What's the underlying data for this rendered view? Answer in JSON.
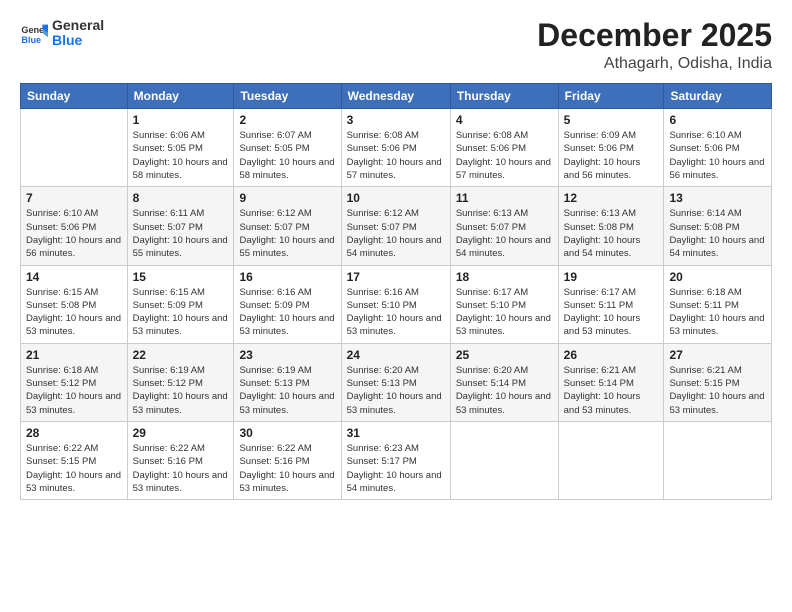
{
  "header": {
    "logo_line1": "General",
    "logo_line2": "Blue",
    "month": "December 2025",
    "location": "Athagarh, Odisha, India"
  },
  "weekdays": [
    "Sunday",
    "Monday",
    "Tuesday",
    "Wednesday",
    "Thursday",
    "Friday",
    "Saturday"
  ],
  "weeks": [
    [
      {
        "day": "",
        "sunrise": "",
        "sunset": "",
        "daylight": ""
      },
      {
        "day": "1",
        "sunrise": "6:06 AM",
        "sunset": "5:05 PM",
        "daylight": "10 hours and 58 minutes."
      },
      {
        "day": "2",
        "sunrise": "6:07 AM",
        "sunset": "5:05 PM",
        "daylight": "10 hours and 58 minutes."
      },
      {
        "day": "3",
        "sunrise": "6:08 AM",
        "sunset": "5:06 PM",
        "daylight": "10 hours and 57 minutes."
      },
      {
        "day": "4",
        "sunrise": "6:08 AM",
        "sunset": "5:06 PM",
        "daylight": "10 hours and 57 minutes."
      },
      {
        "day": "5",
        "sunrise": "6:09 AM",
        "sunset": "5:06 PM",
        "daylight": "10 hours and 56 minutes."
      },
      {
        "day": "6",
        "sunrise": "6:10 AM",
        "sunset": "5:06 PM",
        "daylight": "10 hours and 56 minutes."
      }
    ],
    [
      {
        "day": "7",
        "sunrise": "6:10 AM",
        "sunset": "5:06 PM",
        "daylight": "10 hours and 56 minutes."
      },
      {
        "day": "8",
        "sunrise": "6:11 AM",
        "sunset": "5:07 PM",
        "daylight": "10 hours and 55 minutes."
      },
      {
        "day": "9",
        "sunrise": "6:12 AM",
        "sunset": "5:07 PM",
        "daylight": "10 hours and 55 minutes."
      },
      {
        "day": "10",
        "sunrise": "6:12 AM",
        "sunset": "5:07 PM",
        "daylight": "10 hours and 54 minutes."
      },
      {
        "day": "11",
        "sunrise": "6:13 AM",
        "sunset": "5:07 PM",
        "daylight": "10 hours and 54 minutes."
      },
      {
        "day": "12",
        "sunrise": "6:13 AM",
        "sunset": "5:08 PM",
        "daylight": "10 hours and 54 minutes."
      },
      {
        "day": "13",
        "sunrise": "6:14 AM",
        "sunset": "5:08 PM",
        "daylight": "10 hours and 54 minutes."
      }
    ],
    [
      {
        "day": "14",
        "sunrise": "6:15 AM",
        "sunset": "5:08 PM",
        "daylight": "10 hours and 53 minutes."
      },
      {
        "day": "15",
        "sunrise": "6:15 AM",
        "sunset": "5:09 PM",
        "daylight": "10 hours and 53 minutes."
      },
      {
        "day": "16",
        "sunrise": "6:16 AM",
        "sunset": "5:09 PM",
        "daylight": "10 hours and 53 minutes."
      },
      {
        "day": "17",
        "sunrise": "6:16 AM",
        "sunset": "5:10 PM",
        "daylight": "10 hours and 53 minutes."
      },
      {
        "day": "18",
        "sunrise": "6:17 AM",
        "sunset": "5:10 PM",
        "daylight": "10 hours and 53 minutes."
      },
      {
        "day": "19",
        "sunrise": "6:17 AM",
        "sunset": "5:11 PM",
        "daylight": "10 hours and 53 minutes."
      },
      {
        "day": "20",
        "sunrise": "6:18 AM",
        "sunset": "5:11 PM",
        "daylight": "10 hours and 53 minutes."
      }
    ],
    [
      {
        "day": "21",
        "sunrise": "6:18 AM",
        "sunset": "5:12 PM",
        "daylight": "10 hours and 53 minutes."
      },
      {
        "day": "22",
        "sunrise": "6:19 AM",
        "sunset": "5:12 PM",
        "daylight": "10 hours and 53 minutes."
      },
      {
        "day": "23",
        "sunrise": "6:19 AM",
        "sunset": "5:13 PM",
        "daylight": "10 hours and 53 minutes."
      },
      {
        "day": "24",
        "sunrise": "6:20 AM",
        "sunset": "5:13 PM",
        "daylight": "10 hours and 53 minutes."
      },
      {
        "day": "25",
        "sunrise": "6:20 AM",
        "sunset": "5:14 PM",
        "daylight": "10 hours and 53 minutes."
      },
      {
        "day": "26",
        "sunrise": "6:21 AM",
        "sunset": "5:14 PM",
        "daylight": "10 hours and 53 minutes."
      },
      {
        "day": "27",
        "sunrise": "6:21 AM",
        "sunset": "5:15 PM",
        "daylight": "10 hours and 53 minutes."
      }
    ],
    [
      {
        "day": "28",
        "sunrise": "6:22 AM",
        "sunset": "5:15 PM",
        "daylight": "10 hours and 53 minutes."
      },
      {
        "day": "29",
        "sunrise": "6:22 AM",
        "sunset": "5:16 PM",
        "daylight": "10 hours and 53 minutes."
      },
      {
        "day": "30",
        "sunrise": "6:22 AM",
        "sunset": "5:16 PM",
        "daylight": "10 hours and 53 minutes."
      },
      {
        "day": "31",
        "sunrise": "6:23 AM",
        "sunset": "5:17 PM",
        "daylight": "10 hours and 54 minutes."
      },
      {
        "day": "",
        "sunrise": "",
        "sunset": "",
        "daylight": ""
      },
      {
        "day": "",
        "sunrise": "",
        "sunset": "",
        "daylight": ""
      },
      {
        "day": "",
        "sunrise": "",
        "sunset": "",
        "daylight": ""
      }
    ]
  ]
}
